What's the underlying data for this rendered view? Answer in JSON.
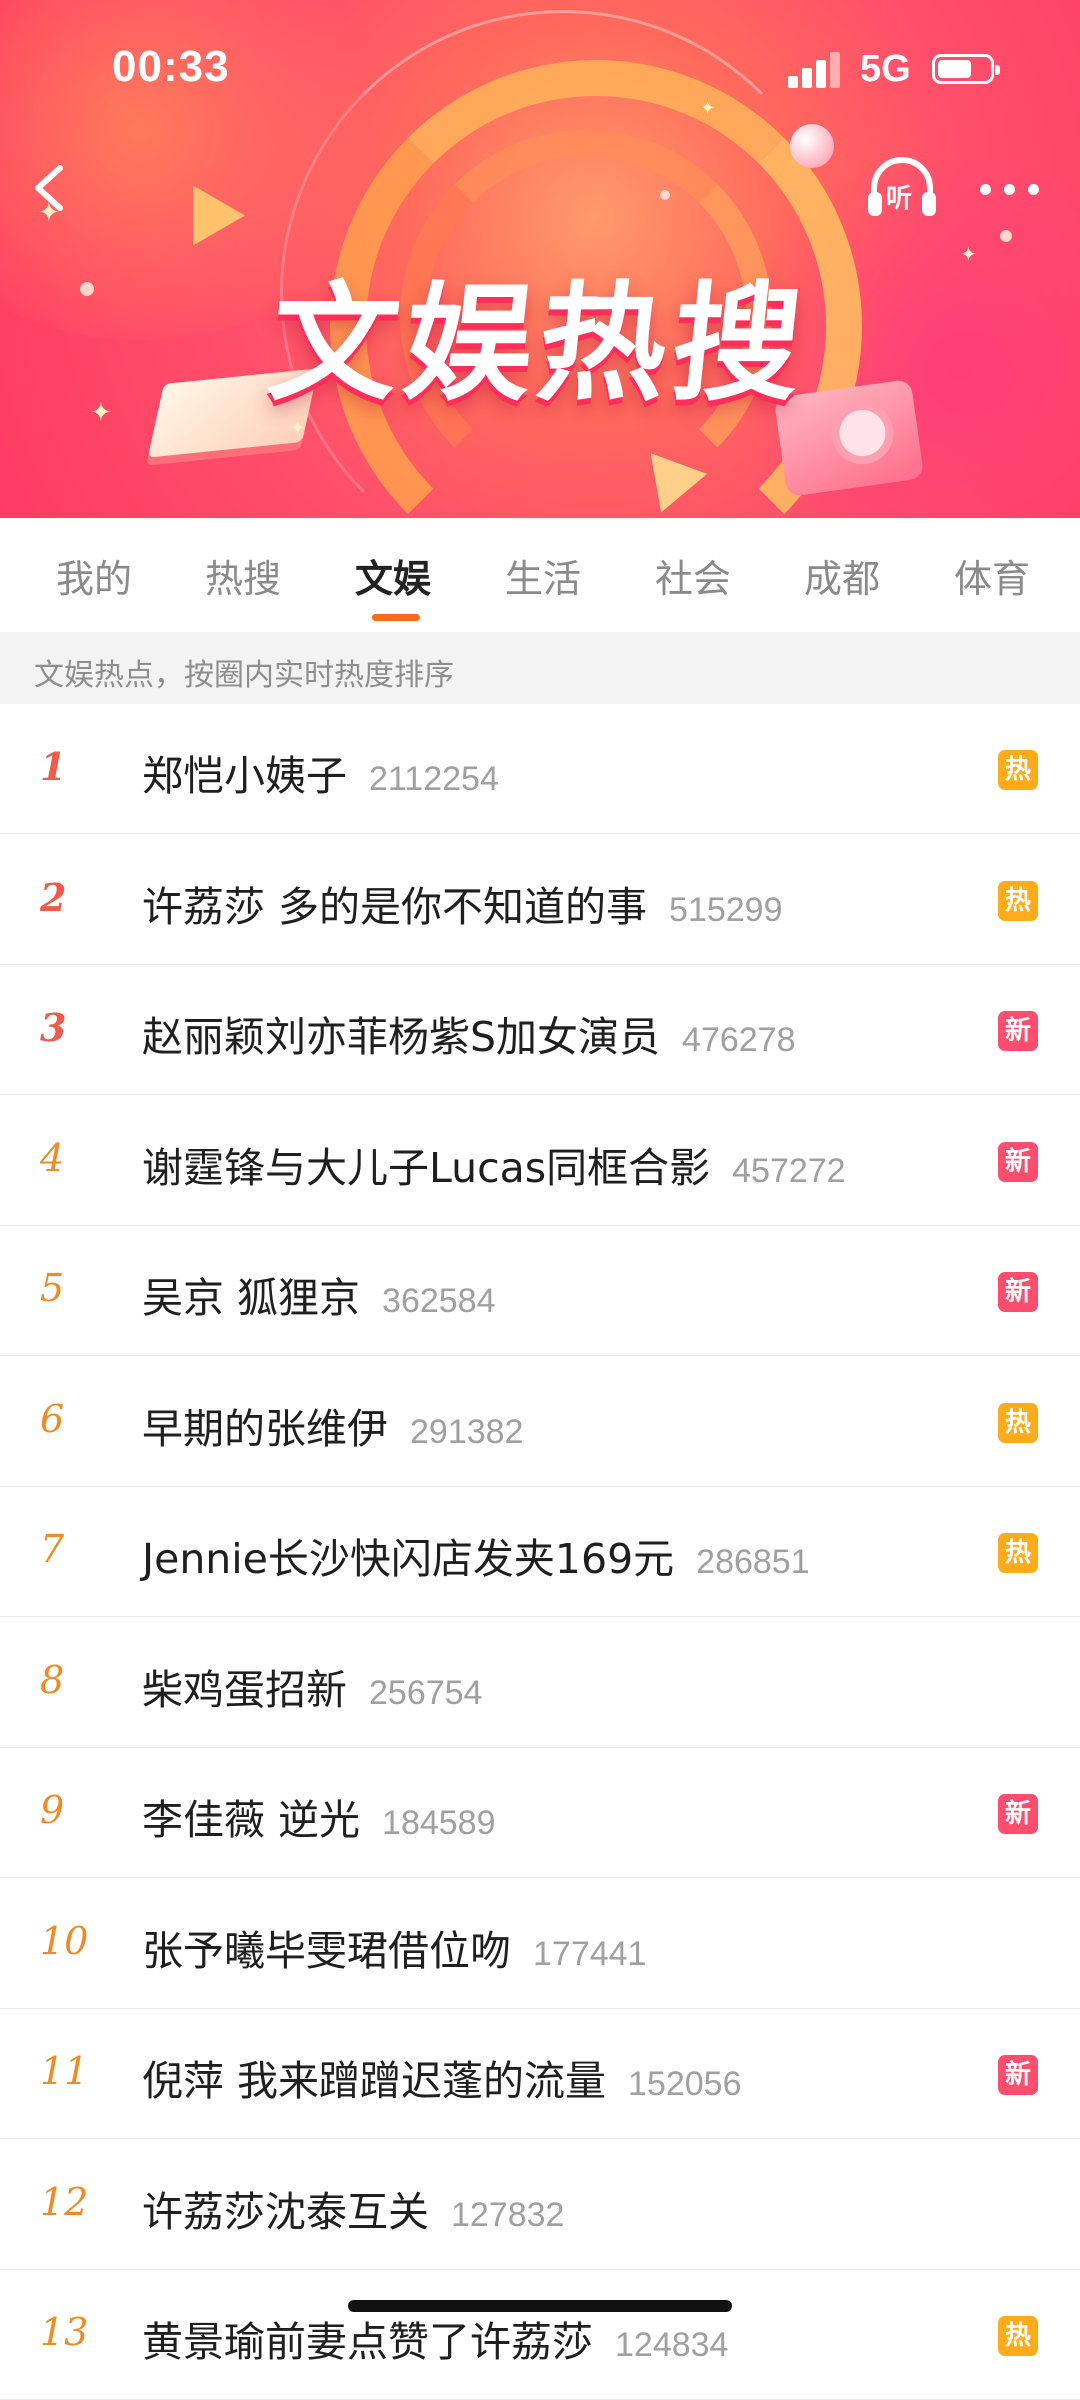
{
  "status_bar": {
    "time": "00:33",
    "network": "5G",
    "battery_level": 0.65
  },
  "header": {
    "title": "文娱热搜",
    "listen_label": "听"
  },
  "tabs": [
    {
      "label": "我的",
      "active": false
    },
    {
      "label": "热搜",
      "active": false
    },
    {
      "label": "文娱",
      "active": true
    },
    {
      "label": "生活",
      "active": false
    },
    {
      "label": "社会",
      "active": false
    },
    {
      "label": "成都",
      "active": false
    },
    {
      "label": "体育",
      "active": false
    }
  ],
  "hint": "文娱热点，按圈内实时热度排序",
  "items": [
    {
      "rank": "1",
      "title": "郑恺小姨子",
      "count": "2112254",
      "badge": "热",
      "badge_type": "hot"
    },
    {
      "rank": "2",
      "title": "许荔莎 多的是你不知道的事",
      "count": "515299",
      "badge": "热",
      "badge_type": "hot"
    },
    {
      "rank": "3",
      "title": "赵丽颖刘亦菲杨紫S加女演员",
      "count": "476278",
      "badge": "新",
      "badge_type": "new"
    },
    {
      "rank": "4",
      "title": "谢霆锋与大儿子Lucas同框合影",
      "count": "457272",
      "badge": "新",
      "badge_type": "new"
    },
    {
      "rank": "5",
      "title": "吴京 狐狸京",
      "count": "362584",
      "badge": "新",
      "badge_type": "new"
    },
    {
      "rank": "6",
      "title": "早期的张维伊",
      "count": "291382",
      "badge": "热",
      "badge_type": "hot"
    },
    {
      "rank": "7",
      "title": "Jennie长沙快闪店发夹169元",
      "count": "286851",
      "badge": "热",
      "badge_type": "hot"
    },
    {
      "rank": "8",
      "title": "柴鸡蛋招新",
      "count": "256754",
      "badge": "",
      "badge_type": ""
    },
    {
      "rank": "9",
      "title": "李佳薇 逆光",
      "count": "184589",
      "badge": "新",
      "badge_type": "new"
    },
    {
      "rank": "10",
      "title": "张予曦毕雯珺借位吻",
      "count": "177441",
      "badge": "",
      "badge_type": ""
    },
    {
      "rank": "11",
      "title": "倪萍 我来蹭蹭迟蓬的流量",
      "count": "152056",
      "badge": "新",
      "badge_type": "new"
    },
    {
      "rank": "12",
      "title": "许荔莎沈泰互关",
      "count": "127832",
      "badge": "",
      "badge_type": ""
    },
    {
      "rank": "13",
      "title": "黄景瑜前妻点赞了许荔莎",
      "count": "124834",
      "badge": "热",
      "badge_type": "hot"
    }
  ]
}
